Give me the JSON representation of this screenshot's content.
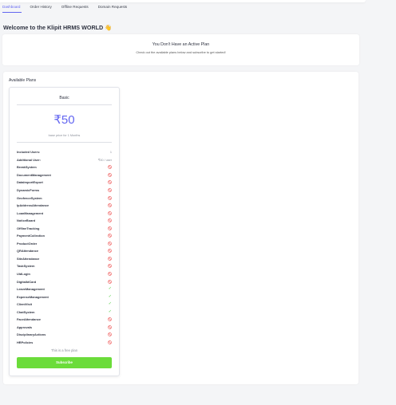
{
  "tabs": [
    {
      "label": "Dashboard",
      "active": true
    },
    {
      "label": "Order History",
      "active": false
    },
    {
      "label": "Offline Requests",
      "active": false
    },
    {
      "label": "Domain Requests",
      "active": false
    }
  ],
  "welcome": {
    "text": "Welcome to the Klipit HRMS WORLD",
    "emoji": "👋"
  },
  "notice": {
    "title": "You Don't Have an Active Plan",
    "subtitle": "Check out the available plans below and subscribe to get started!"
  },
  "plans": {
    "section_title": "Available Plans",
    "card": {
      "name": "Basic",
      "price": "₹50",
      "price_note": "base price for 1 Months",
      "included_users_label": "Included Users:",
      "included_users_value": "1",
      "additional_user_label": "Additional User:",
      "additional_user_value": "₹30 / user",
      "features": [
        {
          "name": "BreakSystem",
          "included": false
        },
        {
          "name": "DocumentManagement",
          "included": false
        },
        {
          "name": "DataImportExport",
          "included": false
        },
        {
          "name": "DynamicForms",
          "included": false
        },
        {
          "name": "GeofenceSystem",
          "included": false
        },
        {
          "name": "IpAddressAttendance",
          "included": false
        },
        {
          "name": "LoanManagement",
          "included": false
        },
        {
          "name": "NoticeBoard",
          "included": false
        },
        {
          "name": "OfflineTracking",
          "included": false
        },
        {
          "name": "PaymentCollection",
          "included": false
        },
        {
          "name": "ProductOrder",
          "included": false
        },
        {
          "name": "QRAttendance",
          "included": false
        },
        {
          "name": "SiteAttendance",
          "included": false
        },
        {
          "name": "TaskSystem",
          "included": false
        },
        {
          "name": "UidLogin",
          "included": false
        },
        {
          "name": "DigitalIdCard",
          "included": false
        },
        {
          "name": "LeaveManagement",
          "included": true
        },
        {
          "name": "ExpenseManagement",
          "included": true
        },
        {
          "name": "ClientVisit",
          "included": true
        },
        {
          "name": "ChatSystem",
          "included": true
        },
        {
          "name": "FaceAttendance",
          "included": false
        },
        {
          "name": "Approvals",
          "included": false
        },
        {
          "name": "DisciplinaryActions",
          "included": false
        },
        {
          "name": "HRPolicies",
          "included": false
        }
      ],
      "free_note": "This is a free plan",
      "subscribe_label": "Subscribe"
    }
  },
  "colors": {
    "accent": "#6366f1",
    "included": "#4ccb3e",
    "excluded": "#f06464",
    "subscribe_bg": "#6bdc3a"
  },
  "icons": {
    "included": "check-icon",
    "excluded": "ban-icon"
  }
}
